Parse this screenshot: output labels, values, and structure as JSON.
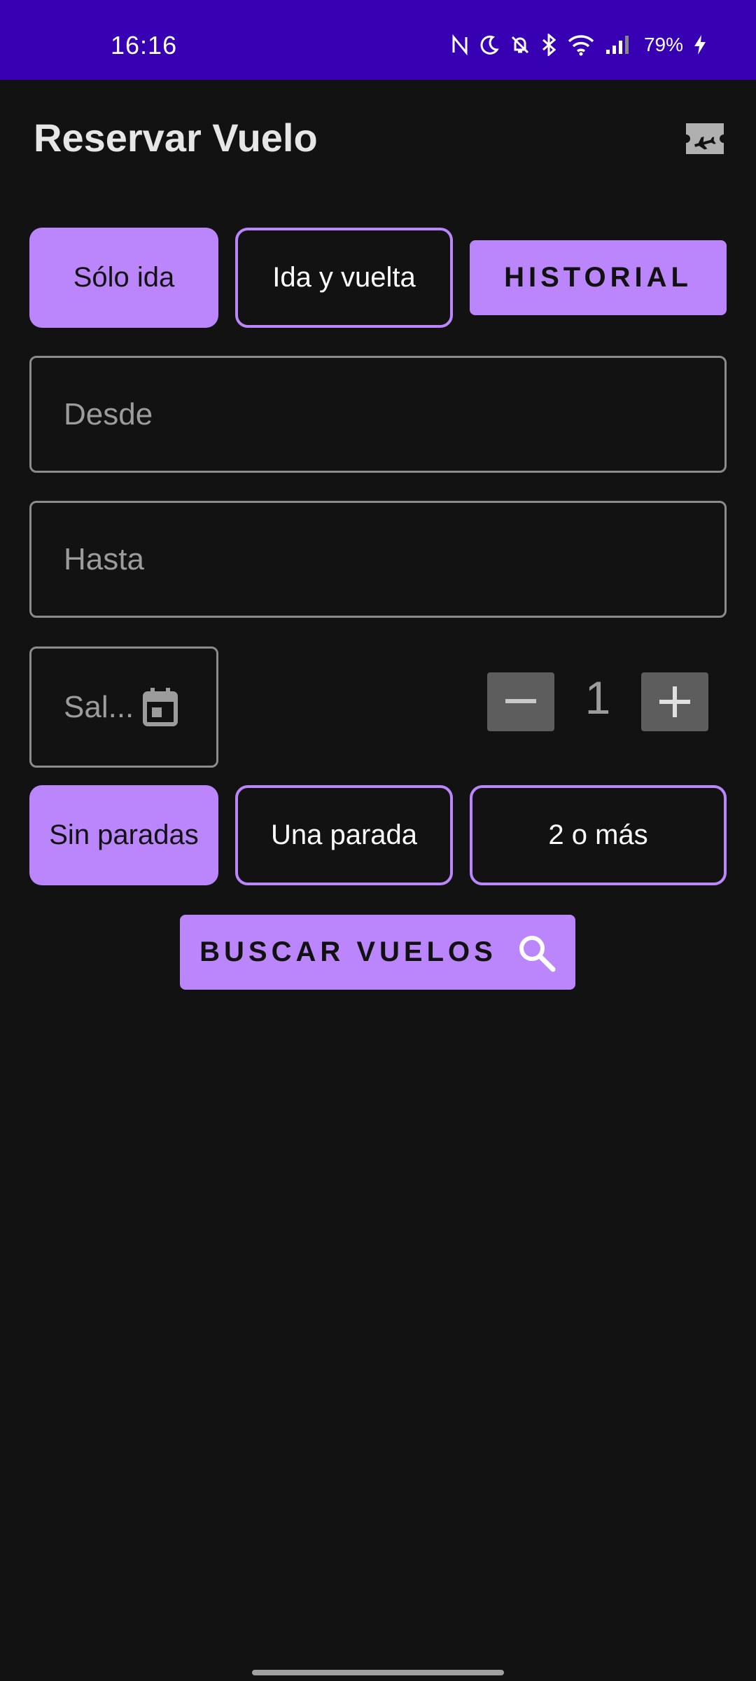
{
  "status_bar": {
    "time": "16:16",
    "battery": "79%",
    "background": "#3700B3",
    "icons": [
      "nfc-icon",
      "moon-icon",
      "bell-off-icon",
      "bluetooth-icon",
      "wifi-icon",
      "signal-icon",
      "battery-charging-icon"
    ]
  },
  "header": {
    "title": "Reservar Vuelo",
    "icon": "ticket-plane-icon"
  },
  "trip_type": {
    "one_way": "Sólo ida",
    "round_trip": "Ida y vuelta",
    "selected": "one_way"
  },
  "history_button": "HISTORIAL",
  "from_field": {
    "placeholder": "Desde",
    "value": ""
  },
  "to_field": {
    "placeholder": "Hasta",
    "value": ""
  },
  "date_field": {
    "placeholder": "Sal...",
    "icon": "calendar-icon"
  },
  "passengers": {
    "value": "1",
    "decrement_icon": "minus-icon",
    "increment_icon": "plus-icon"
  },
  "stops": {
    "none": "Sin paradas",
    "one": "Una parada",
    "two_plus": "2 o más",
    "selected": "none"
  },
  "search_button": {
    "label": "BUSCAR VUELOS",
    "icon": "search-icon"
  },
  "colors": {
    "accent": "#BB86FC",
    "background": "#121212",
    "stepper": "#5d5d5d"
  }
}
